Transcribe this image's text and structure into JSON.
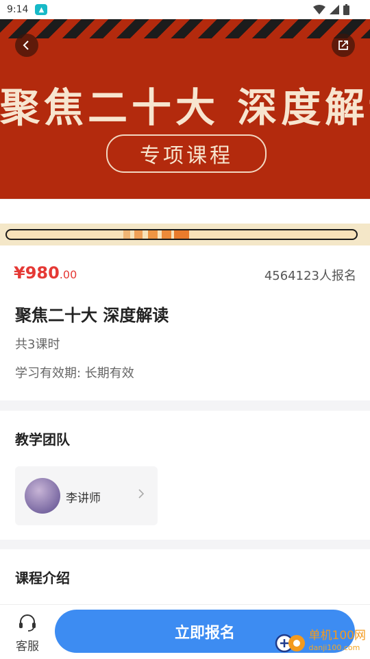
{
  "status_bar": {
    "time": "9:14"
  },
  "banner": {
    "title": "聚焦二十大 深度解读",
    "subtitle": "专项课程"
  },
  "course": {
    "price_main": "¥980",
    "price_decimal": ".00",
    "enrollment": "4564123人报名",
    "title": "聚焦二十大 深度解读",
    "lessons": "共3课时",
    "validity": "学习有效期: 长期有效"
  },
  "team": {
    "heading": "教学团队",
    "teacher_name": "李讲师"
  },
  "intro": {
    "heading": "课程介绍"
  },
  "bottom_bar": {
    "service_label": "客服",
    "enroll_button": "立即报名"
  },
  "watermark": {
    "name": "单机100网",
    "url": "danji100.com"
  },
  "colors": {
    "accent": "#3d8cf2",
    "price": "#e53935",
    "banner": "#b32a0d"
  }
}
